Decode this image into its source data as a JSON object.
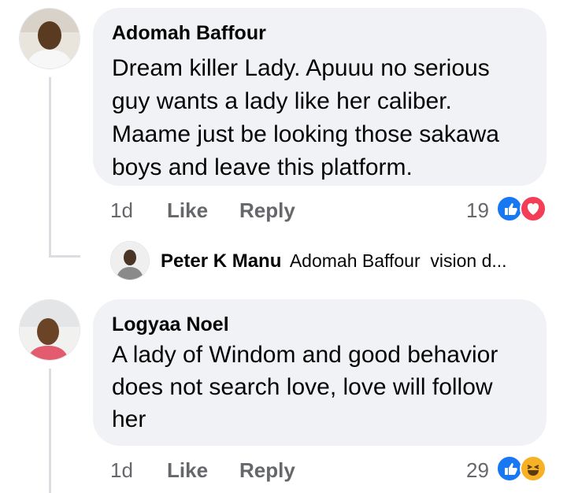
{
  "comments": [
    {
      "author": "Adomah Baffour",
      "text_lines": [
        "Dream killer Lady. Apuuu no serious",
        "guy wants a lady like her caliber.",
        "Maame just be looking those sakawa",
        "boys and leave this platform."
      ],
      "time": "1d",
      "like_label": "Like",
      "reply_label": "Reply",
      "reaction_count": "19",
      "reactions": [
        "like-reaction-icon",
        "love-reaction-icon"
      ]
    },
    {
      "author": "Logyaa Noel",
      "text_lines": [
        "A lady of Windom and good behavior",
        "does not search love, love will follow",
        "her"
      ],
      "time": "1d",
      "like_label": "Like",
      "reply_label": "Reply",
      "reaction_count": "29",
      "reactions": [
        "like-reaction-icon",
        "haha-reaction-icon"
      ]
    }
  ],
  "reply_preview": {
    "author": "Peter K Manu",
    "text": "Adomah Baffour  vision d..."
  },
  "colors": {
    "bubble": "#f0f2f5",
    "meta_text": "#65676b",
    "like_blue": "#1877f2",
    "love_red": "#f33e58",
    "haha_yellow": "#f7b125"
  }
}
